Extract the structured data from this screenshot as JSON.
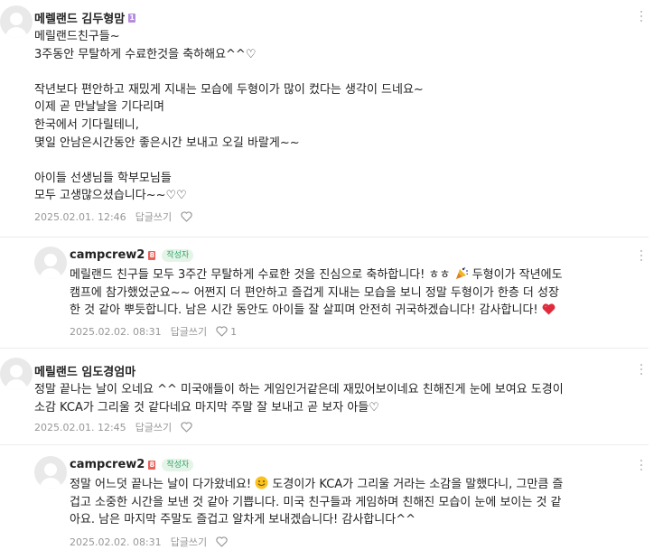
{
  "comments": [
    {
      "author": "메렐랜드 김두형맘",
      "badge": "1",
      "text": "메릴랜드친구들~\n3주동안 무탈하게 수료한것을 축하해요^^♡\n\n작년보다 편안하고 재밌게 지내는 모습에 두형이가 많이 컸다는 생각이 드네요~\n이제 곧 만날날을 기다리며\n한국에서 기다릴테니,\n몇일 안남은시간동안 좋은시간 보내고 오길 바랄게~~\n\n아이들 선생님들 학부모님들\n모두 고생많으셨습니다~~♡♡",
      "date": "2025.02.01. 12:46",
      "reply_label": "답글쓰기",
      "likes": ""
    },
    {
      "author": "campcrew2",
      "badge": "8",
      "writer_tag": "작성자",
      "text_parts": [
        "메릴랜드 친구들 모두 3주간 무탈하게 수료한 것을 진심으로 축하합니다! ㅎㅎ ",
        " 두형이가 작년에도\n캠프에 참가했었군요~~ 어쩐지 더 편안하고 즐겁게 지내는 모습을 보니 정말 두형이가 한층 더 성장\n한 것 같아 뿌듯합니다. 남은 시간 동안도 아이들 잘 살피며 안전히 귀국하겠습니다! 감사합니다! "
      ],
      "date": "2025.02.02. 08:31",
      "reply_label": "답글쓰기",
      "likes": "1"
    },
    {
      "author": "메릴랜드 임도경엄마",
      "text": "정말 끝나는 날이 오네요 ^^ 미국애들이 하는 게임인거같은데 재밌어보이네요 친해진게 눈에 보여요 도경이\n소감 KCA가 그리울 것 같다네요 마지막 주말 잘 보내고 곧 보자 아들♡",
      "date": "2025.02.01. 12:45",
      "reply_label": "답글쓰기",
      "likes": ""
    },
    {
      "author": "campcrew2",
      "badge": "8",
      "writer_tag": "작성자",
      "text_parts": [
        "정말 어느덧 끝나는 날이 다가왔네요! ",
        " 도경이가 KCA가 그리울 거라는 소감을 말했다니, 그만큼 즐\n겁고 소중한 시간을 보낸 것 같아 기쁩니다. 미국 친구들과 게임하며 친해진 모습이 눈에 보이는 것 같\n아요. 남은 마지막 주말도 즐겁고 알차게 보내겠습니다! 감사합니다^^"
      ],
      "date": "2025.02.02. 08:31",
      "reply_label": "답글쓰기",
      "likes": ""
    }
  ],
  "colors": {
    "writer_tag_bg": "#e4f5e8",
    "writer_tag_text": "#35a26b",
    "badge_purple": "#b58ce0",
    "badge_red": "#e8615a",
    "meta_gray": "#979797"
  },
  "icons": [
    "more-options-icon",
    "heart-icon",
    "party-popper-emoji",
    "red-heart-emoji",
    "smile-emoji",
    "avatar-placeholder"
  ]
}
